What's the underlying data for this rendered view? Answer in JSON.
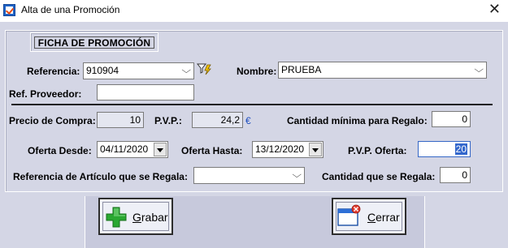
{
  "window": {
    "title": "Alta de una Promoción",
    "close_glyph": "✕"
  },
  "section": {
    "heading": "FICHA DE PROMOCIÓN"
  },
  "form": {
    "referencia": {
      "label": "Referencia:",
      "value": "910904"
    },
    "nombre": {
      "label": "Nombre:",
      "value": "PRUEBA"
    },
    "ref_proveedor": {
      "label": "Ref. Proveedor:",
      "value": ""
    },
    "precio_compra": {
      "label": "Precio de Compra:",
      "value": "10"
    },
    "pvp": {
      "label": "P.V.P.:",
      "value": "24,2",
      "currency": "€"
    },
    "cantidad_minima": {
      "label": "Cantidad mínima para Regalo:",
      "value": "0"
    },
    "oferta_desde": {
      "label": "Oferta Desde:",
      "value": "04/11/2020"
    },
    "oferta_hasta": {
      "label": "Oferta Hasta:",
      "value": "13/12/2020"
    },
    "pvp_oferta": {
      "label": "P.V.P. Oferta:",
      "value": "20"
    },
    "articulo_regala": {
      "label": "Referencia de Artículo que se Regala:",
      "value": ""
    },
    "cantidad_regala": {
      "label": "Cantidad que se Regala:",
      "value": "0"
    }
  },
  "buttons": {
    "grabar": {
      "mnemonic": "G",
      "rest": "rabar",
      "icon": "plus-icon"
    },
    "cerrar": {
      "mnemonic": "C",
      "rest": "errar",
      "icon": "close-window-icon"
    }
  },
  "colors": {
    "background": "#d4d6e5",
    "accent_green": "#27a62c",
    "selection": "#3367cc"
  }
}
